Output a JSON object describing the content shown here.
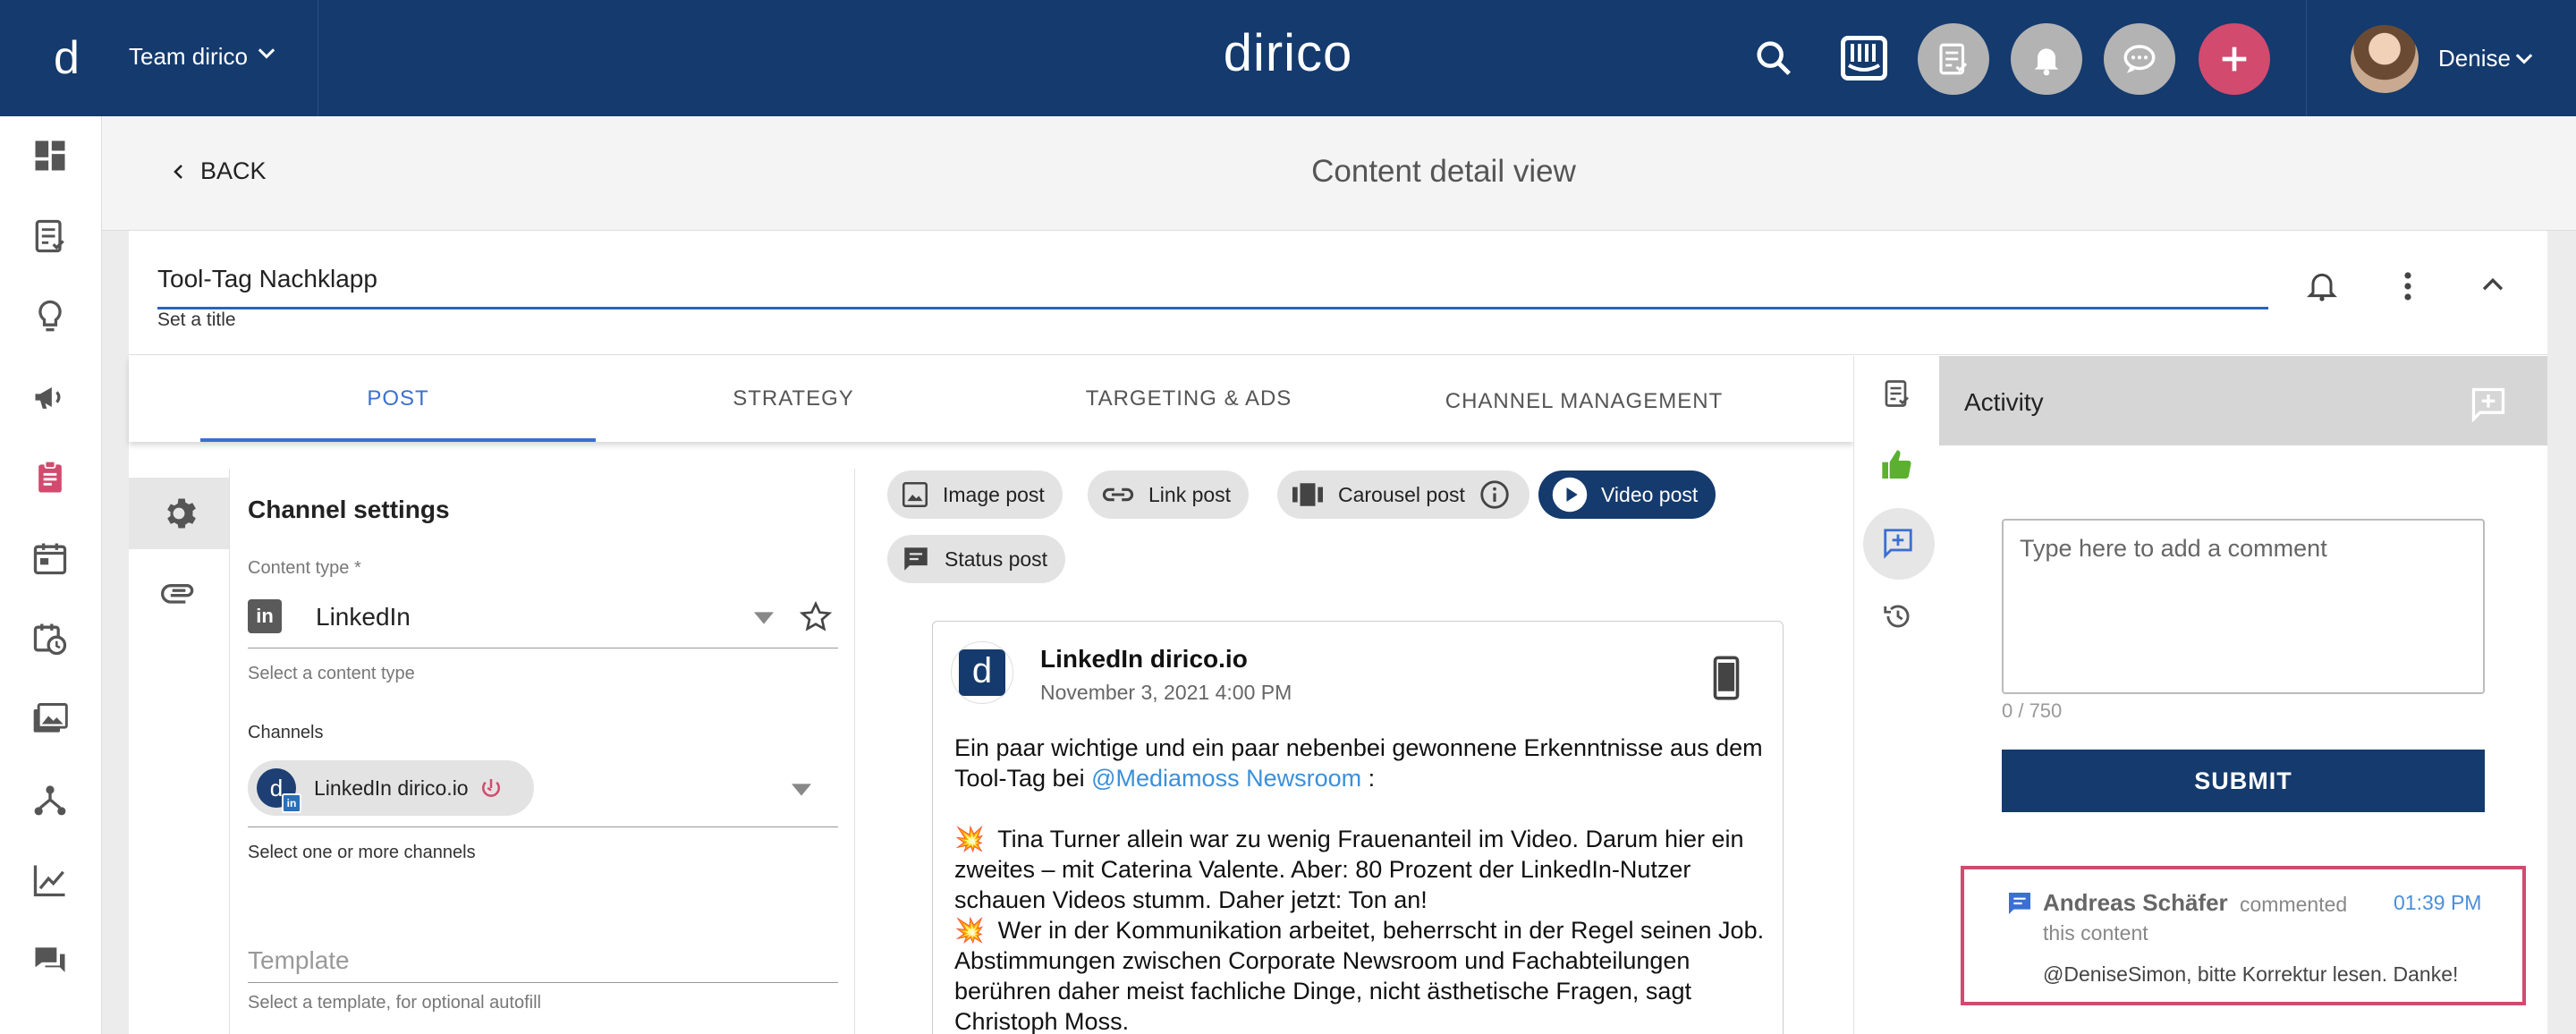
{
  "header": {
    "team_label": "Team dirico",
    "brand": "dirico",
    "user_name": "Denise",
    "logo_letter": "d"
  },
  "subheader": {
    "back_label": "BACK",
    "page_title": "Content detail view"
  },
  "content": {
    "title_value": "Tool-Tag Nachklapp",
    "title_hint": "Set a title"
  },
  "tabs": [
    {
      "label": "POST"
    },
    {
      "label": "STRATEGY"
    },
    {
      "label": "TARGETING & ADS"
    },
    {
      "label": "CHANNEL MANAGEMENT"
    }
  ],
  "channel_settings": {
    "title": "Channel settings",
    "content_type_label": "Content type *",
    "content_type_value": "LinkedIn",
    "content_type_hint": "Select a content type",
    "channels_label": "Channels",
    "channel_chip": "LinkedIn dirico.io",
    "channels_hint": "Select one or more channels",
    "template_label": "Template",
    "template_hint": "Select a template, for optional autofill"
  },
  "post_types": [
    {
      "label": "Image post"
    },
    {
      "label": "Link post"
    },
    {
      "label": "Carousel post"
    },
    {
      "label": "Video post"
    },
    {
      "label": "Status post"
    }
  ],
  "preview": {
    "account_name": "LinkedIn dirico.io",
    "date": "November 3, 2021 4:00 PM",
    "intro": "Ein paar wichtige und ein paar nebenbei gewonnene Erkenntnisse aus dem Tool-Tag bei",
    "mention": "@Mediamoss Newsroom",
    "intro_end": ":",
    "point1": "Tina Turner allein war zu wenig Frauenanteil im Video. Darum hier ein zweites – mit Caterina Valente. Aber: 80 Prozent der LinkedIn-Nutzer schauen Videos stumm. Daher jetzt: Ton an!",
    "point2": "Wer in der Kommunikation arbeitet, beherrscht in der Regel seinen Job. Abstimmungen zwischen Corporate Newsroom und Fachabteilungen berühren daher meist fachliche Dinge, nicht ästhetische Fragen, sagt Christoph Moss.",
    "emoji": "💥"
  },
  "activity": {
    "title": "Activity",
    "comment_placeholder": "Type here to add a comment",
    "counter": "0 / 750",
    "submit_label": "SUBMIT",
    "log": {
      "author": "Andreas Schäfer",
      "verb": "commented",
      "object": "this content",
      "time": "01:39 PM",
      "message": "@DeniseSimon, bitte Korrektur lesen. Danke!"
    }
  },
  "colors": {
    "primary": "#143a6e",
    "accent": "#3b6fd1",
    "highlight": "#d24a6e"
  }
}
